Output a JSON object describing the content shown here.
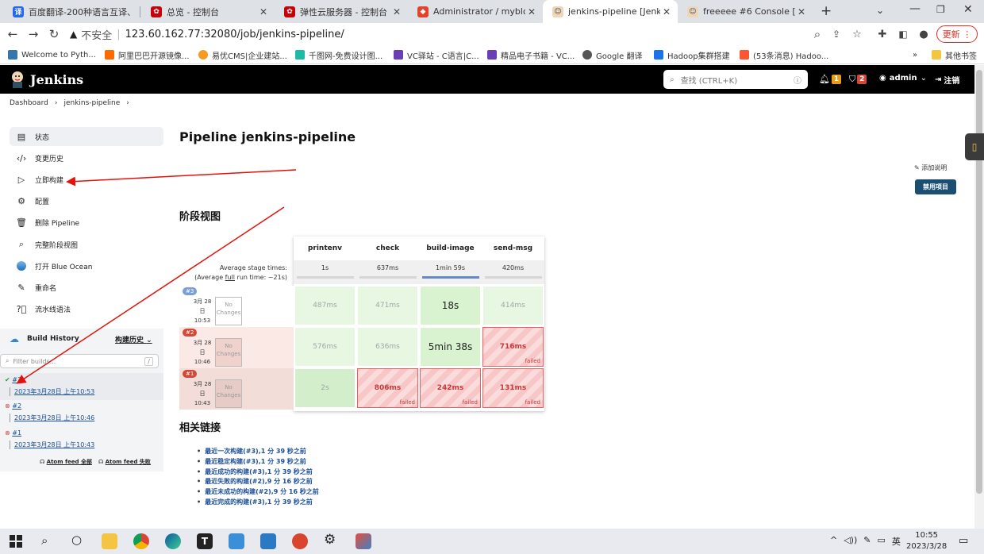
{
  "browser": {
    "tabs": [
      {
        "label": "百度翻译-200种语言互译、",
        "color": "#2468f2",
        "icon": "baidu-translate-icon"
      },
      {
        "label": "总览 - 控制台",
        "color": "#c7000b",
        "icon": "huawei-icon"
      },
      {
        "label": "弹性云服务器 - 控制台",
        "color": "#c7000b",
        "icon": "huawei-icon"
      },
      {
        "label": "Administrator / myblog",
        "color": "#e24329",
        "icon": "gitlab-icon"
      },
      {
        "label": "jenkins-pipeline [Jenkins]",
        "color": "#335061",
        "icon": "jenkins-icon"
      },
      {
        "label": "freeeee #6 Console [Jenk",
        "color": "#335061",
        "icon": "jenkins-icon"
      }
    ],
    "security_label": "不安全",
    "url": "123.60.162.77:32080/job/jenkins-pipeline/",
    "update_label": "更新",
    "bookmarks": [
      {
        "label": "Welcome to Pyth...",
        "color": "#3776ab"
      },
      {
        "label": "阿里巴巴开源镜像...",
        "color": "#ff6a00"
      },
      {
        "label": "易优CMS|企业建站...",
        "color": "#f59a23"
      },
      {
        "label": "千图网-免费设计图...",
        "color": "#1fbaa6"
      },
      {
        "label": "VC驿站 - C语言|C...",
        "color": "#6a3fb5"
      },
      {
        "label": "精品电子书籍 - VC...",
        "color": "#6a3fb5"
      },
      {
        "label": "Google 翻译",
        "color": "#4285f4"
      },
      {
        "label": "Hadoop集群搭建",
        "color": "#1a73e8"
      },
      {
        "label": "(53条消息) Hadoo...",
        "color": "#fc5531"
      }
    ],
    "other_bookmarks": "其他书签"
  },
  "jenkins": {
    "brand": "Jenkins",
    "search_placeholder": "查找 (CTRL+K)",
    "notifications_count": "1",
    "security_count": "2",
    "user": "admin",
    "logout": "注销",
    "breadcrumb": [
      "Dashboard",
      "jenkins-pipeline"
    ],
    "sidebar": [
      {
        "label": "状态",
        "icon": "document-icon"
      },
      {
        "label": "变更历史",
        "icon": "code-icon"
      },
      {
        "label": "立即构建",
        "icon": "play-icon"
      },
      {
        "label": "配置",
        "icon": "gear-icon"
      },
      {
        "label": "删除 Pipeline",
        "icon": "trash-icon"
      },
      {
        "label": "完整阶段视图",
        "icon": "search-icon"
      },
      {
        "label": "打开 Blue Ocean",
        "icon": "blue-ocean-icon"
      },
      {
        "label": "重命名",
        "icon": "pencil-icon"
      },
      {
        "label": "流水线语法",
        "icon": "help-icon"
      }
    ],
    "build_history": {
      "title": "Build History",
      "trend_link": "构建历史",
      "filter_placeholder": "Filter builds...",
      "filter_shortcut": "/",
      "builds": [
        {
          "id": "#3",
          "status": "success",
          "time": "2023年3月28日 上午10:53"
        },
        {
          "id": "#2",
          "status": "failed",
          "time": "2023年3月28日 上午10:46"
        },
        {
          "id": "#1",
          "status": "failed",
          "time": "2023年3月28日 上午10:43"
        }
      ],
      "feed_all": "Atom feed 全部",
      "feed_failed": "Atom feed 失败"
    },
    "page_title": "Pipeline jenkins-pipeline",
    "add_description": "添加说明",
    "disable_project": "禁用项目",
    "stage_view_title": "阶段视图",
    "stage_view": {
      "avg_stage_label": "Average stage times:",
      "avg_run_label_prefix": "(Average ",
      "avg_run_label_link": "full",
      "avg_run_label_suffix": " run time: ~21s)",
      "stages": [
        {
          "name": "printenv",
          "avg": "1s"
        },
        {
          "name": "check",
          "avg": "637ms"
        },
        {
          "name": "build-image",
          "avg": "1min 59s"
        },
        {
          "name": "send-msg",
          "avg": "420ms"
        }
      ],
      "runs": [
        {
          "badge": "#3",
          "date_line1": "3月 28",
          "date_line2": "日",
          "time": "10:53",
          "no_changes": "No Changes",
          "cells": [
            {
              "value": "487ms",
              "status": "ok"
            },
            {
              "value": "471ms",
              "status": "ok"
            },
            {
              "value": "18s",
              "status": "okbig"
            },
            {
              "value": "414ms",
              "status": "ok"
            }
          ]
        },
        {
          "badge": "#2",
          "date_line1": "3月 28",
          "date_line2": "日",
          "time": "10:46",
          "no_changes": "No Changes",
          "cells": [
            {
              "value": "576ms",
              "status": "ok"
            },
            {
              "value": "636ms",
              "status": "ok"
            },
            {
              "value": "5min 38s",
              "status": "okbig"
            },
            {
              "value": "716ms",
              "status": "fail"
            }
          ]
        },
        {
          "badge": "#1",
          "date_line1": "3月 28",
          "date_line2": "日",
          "time": "10:43",
          "no_changes": "No Changes",
          "cells": [
            {
              "value": "2s",
              "status": "okd"
            },
            {
              "value": "806ms",
              "status": "fail"
            },
            {
              "value": "242ms",
              "status": "fail"
            },
            {
              "value": "131ms",
              "status": "fail"
            }
          ]
        }
      ],
      "failed_label": "failed"
    },
    "related_title": "相关链接",
    "related_links": [
      "最近一次构建(#3),1 分 39 秒之前",
      "最近稳定构建(#3),1 分 39 秒之前",
      "最近成功的构建(#3),1 分 39 秒之前",
      "最近失败的构建(#2),9 分 16 秒之前",
      "最近未成功的构建(#2),9 分 16 秒之前",
      "最近完成的构建(#3),1 分 39 秒之前"
    ]
  },
  "taskbar": {
    "ime": "英",
    "time": "10:55",
    "date": "2023/3/28"
  }
}
